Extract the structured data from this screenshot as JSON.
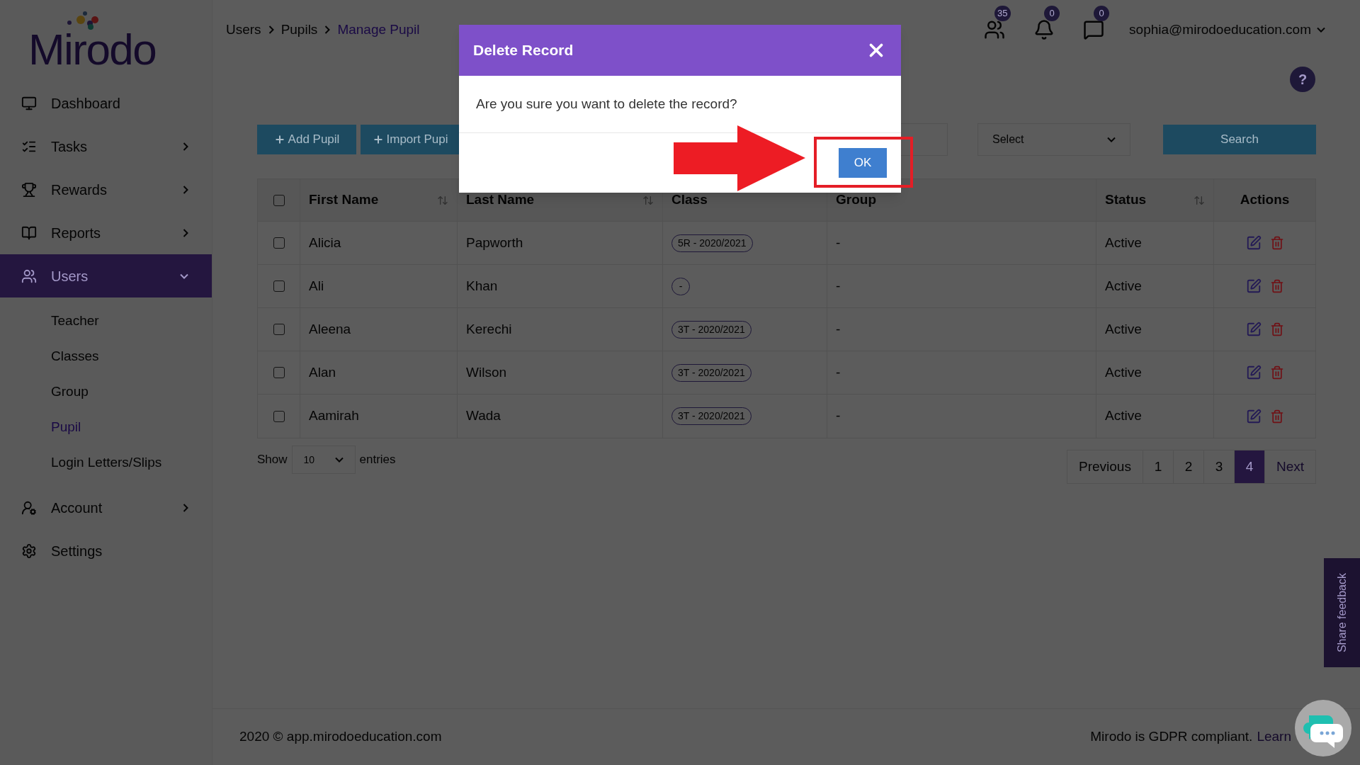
{
  "logo": {
    "text": "Mirodo"
  },
  "sidebar": {
    "items": [
      {
        "label": "Dashboard",
        "kind": "link",
        "selected": false
      },
      {
        "label": "Tasks",
        "kind": "menu",
        "selected": false,
        "expanded": false
      },
      {
        "label": "Rewards",
        "kind": "menu",
        "selected": false,
        "expanded": false
      },
      {
        "label": "Reports",
        "kind": "menu",
        "selected": false,
        "expanded": false
      },
      {
        "label": "Users",
        "kind": "menu",
        "selected": true,
        "expanded": true,
        "children": [
          {
            "label": "Teacher",
            "selected": false
          },
          {
            "label": "Classes",
            "selected": false
          },
          {
            "label": "Group",
            "selected": false
          },
          {
            "label": "Pupil",
            "selected": true
          },
          {
            "label": "Login Letters/Slips",
            "selected": false
          }
        ]
      },
      {
        "label": "Account",
        "kind": "menu",
        "selected": false,
        "expanded": false
      },
      {
        "label": "Settings",
        "kind": "link",
        "selected": false
      }
    ]
  },
  "breadcrumb": [
    {
      "label": "Users",
      "current": false
    },
    {
      "label": "Pupils",
      "current": false
    },
    {
      "label": "Manage Pupil",
      "current": true
    }
  ],
  "header": {
    "badges": [
      "35",
      "0",
      "0"
    ],
    "user": "sophia@mirodoeducation.com",
    "help": "?"
  },
  "toolbar": {
    "buttons": [
      "Add Pupil",
      "Import Pupi"
    ],
    "select": {
      "placeholder": "Select"
    },
    "search_button": "Search"
  },
  "table": {
    "all_selected": false,
    "columns": [
      {
        "label": "First Name",
        "sortable": true
      },
      {
        "label": "Last Name",
        "sortable": true
      },
      {
        "label": "Class",
        "sortable": false
      },
      {
        "label": "Group",
        "sortable": false
      },
      {
        "label": "Status",
        "sortable": true
      },
      {
        "label": "Actions",
        "sortable": false
      }
    ],
    "rows": [
      {
        "selected": false,
        "first_name": "Alicia",
        "last_name": "Papworth",
        "class": "5R - 2020/2021",
        "group": "-",
        "status": "Active"
      },
      {
        "selected": false,
        "first_name": "Ali",
        "last_name": "Khan",
        "class": "-",
        "group": "-",
        "status": "Active"
      },
      {
        "selected": false,
        "first_name": "Aleena",
        "last_name": "Kerechi",
        "class": "3T - 2020/2021",
        "group": "-",
        "status": "Active"
      },
      {
        "selected": false,
        "first_name": "Alan",
        "last_name": "Wilson",
        "class": "3T - 2020/2021",
        "group": "-",
        "status": "Active"
      },
      {
        "selected": false,
        "first_name": "Aamirah",
        "last_name": "Wada",
        "class": "3T - 2020/2021",
        "group": "-",
        "status": "Active"
      }
    ]
  },
  "entries": {
    "show": "Show",
    "value": "10",
    "suffix": "entries"
  },
  "pagination": {
    "previous": "Previous",
    "next": "Next",
    "pages": [
      {
        "label": "1",
        "selected": false
      },
      {
        "label": "2",
        "selected": false
      },
      {
        "label": "3",
        "selected": false
      },
      {
        "label": "4",
        "selected": true
      }
    ]
  },
  "footer": {
    "copyright": "2020 © app.mirodoeducation.com",
    "gdpr": "Mirodo is GDPR compliant.",
    "link": "Learn"
  },
  "feedback": "Share feedback",
  "modal": {
    "title": "Delete Record",
    "message": "Are you sure you want to delete the record?",
    "ok": "OK"
  }
}
